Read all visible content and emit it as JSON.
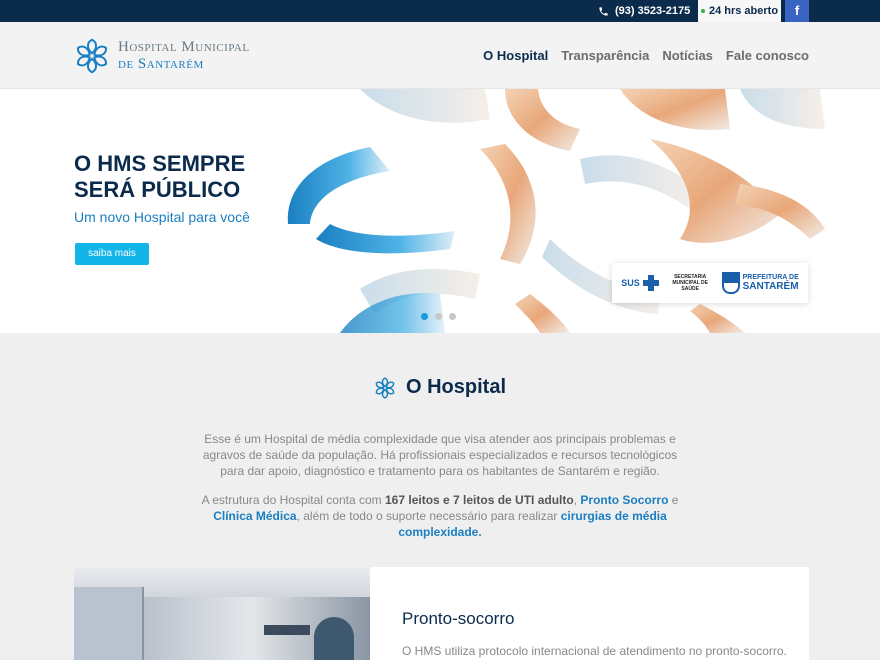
{
  "topbar": {
    "phone": "(93) 3523-2175",
    "phone_icon": "phone-icon",
    "hours": "24 hrs aberto",
    "facebook_label": "f"
  },
  "header": {
    "logo_line1": "Hospital Municipal",
    "logo_line2": "de Santarém",
    "nav": [
      {
        "label": "O Hospital",
        "active": true
      },
      {
        "label": "Transparência",
        "active": false
      },
      {
        "label": "Notícias",
        "active": false
      },
      {
        "label": "Fale conosco",
        "active": false
      }
    ]
  },
  "hero": {
    "title": "O HMS SEMPRE SERÁ PÚBLICO",
    "subtitle": "Um novo Hospital para você",
    "button": "saiba mais",
    "partners": {
      "sus": "SUS",
      "sec": "SECRETARIA MUNICIPAL DE SAÚDE",
      "pref_line1": "PREFEITURA DE",
      "pref_line2": "SANTARÉM"
    },
    "slides": 3,
    "active_slide": 1
  },
  "about": {
    "title": "O Hospital",
    "p1": "Esse é um Hospital de média complexidade que visa atender aos principais problemas e agravos de saúde da população. Há profissionais especializados e recursos tecnológicos para dar apoio, diagnóstico e tratamento para os habitantes de Santarém e região.",
    "p2_a": "A estrutura do Hospital conta com ",
    "p2_b": "167 leitos e 7 leitos de UTI adulto",
    "p2_c": ", ",
    "p2_d": "Pronto Socorro",
    "p2_e": " e ",
    "p2_f": "Clínica Médica",
    "p2_g": ", além de todo o suporte necessário para realizar ",
    "p2_h": "cirurgias de média complexidade."
  },
  "card": {
    "title": "Pronto-socorro",
    "text": "O HMS utiliza protocolo internacional de atendimento no pronto-socorro."
  },
  "colors": {
    "navy": "#0b2b4d",
    "blue": "#1a7fc1",
    "cyan": "#13b4e8",
    "facebook": "#3a64c4"
  }
}
